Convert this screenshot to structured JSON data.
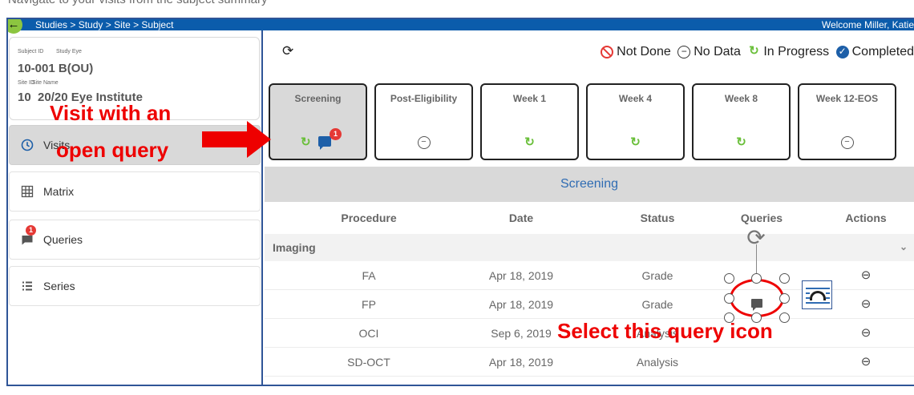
{
  "top_strip": {
    "text": "Navigate to your visits from the subject summary"
  },
  "header": {
    "back_icon": "arrow-left-icon",
    "breadcrumb": "Studies > Study > Site > Subject",
    "welcome": "Welcome Miller, Katie"
  },
  "subject": {
    "subject_id_label": "Subject ID",
    "study_eye_label": "Study Eye",
    "subject_id": "10-001",
    "study_eye": "B(OU)",
    "site_id_label": "Site ID",
    "site_name_label": "Site Name",
    "site_id": "10",
    "site_name": "20/20 Eye Institute"
  },
  "sidebar": {
    "items": [
      {
        "label": "Visits",
        "icon": "clock-icon",
        "active": true
      },
      {
        "label": "Matrix",
        "icon": "grid-icon"
      },
      {
        "label": "Queries",
        "icon": "chat-icon",
        "badge": "1"
      },
      {
        "label": "Series",
        "icon": "list-icon"
      }
    ]
  },
  "legend": {
    "not_done": "Not Done",
    "no_data": "No Data",
    "in_progress": "In Progress",
    "completed": "Completed"
  },
  "visits": [
    {
      "label": "Screening",
      "status": "in-progress",
      "badge": "1",
      "selected": true
    },
    {
      "label": "Post-Eligibility",
      "status": "no-data"
    },
    {
      "label": "Week 1",
      "status": "in-progress"
    },
    {
      "label": "Week 4",
      "status": "in-progress"
    },
    {
      "label": "Week 8",
      "status": "in-progress"
    },
    {
      "label": "Week 12-EOS",
      "status": "no-data"
    }
  ],
  "section_title": "Screening",
  "table": {
    "headers": [
      "Procedure",
      "Date",
      "Status",
      "Queries",
      "Actions"
    ],
    "group": "Imaging",
    "rows": [
      {
        "procedure": "FA",
        "date": "Apr 18, 2019",
        "status": "Grade",
        "query": false
      },
      {
        "procedure": "FP",
        "date": "Apr 18, 2019",
        "status": "Grade",
        "query": true
      },
      {
        "procedure": "OCI",
        "date": "Sep 6, 2019",
        "status": "Analysis",
        "query": false
      },
      {
        "procedure": "SD-OCT",
        "date": "Apr 18, 2019",
        "status": "Analysis",
        "query": false
      }
    ]
  },
  "annotations": {
    "visit_note_line1": "Visit with an",
    "visit_note_line2": "open query",
    "query_note": "Select this query icon"
  },
  "colors": {
    "header_blue": "#0b5cab",
    "annotation_red": "#ee0000",
    "in_progress_green": "#6abf3a",
    "completed_blue": "#1d5fa8"
  }
}
